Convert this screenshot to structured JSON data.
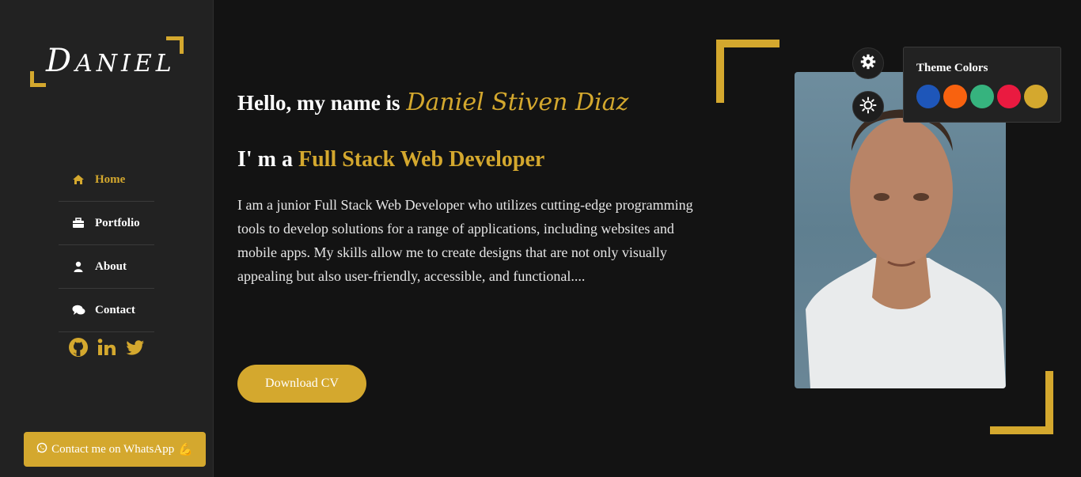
{
  "logo": {
    "first": "D",
    "rest": "ANIEL"
  },
  "nav": [
    {
      "label": "Home",
      "icon": "home-icon"
    },
    {
      "label": "Portfolio",
      "icon": "briefcase-icon"
    },
    {
      "label": "About",
      "icon": "user-icon"
    },
    {
      "label": "Contact",
      "icon": "comments-icon"
    }
  ],
  "socials": [
    "github-icon",
    "linkedin-icon",
    "twitter-icon"
  ],
  "whatsapp": {
    "label": "Contact me on WhatsApp",
    "emoji": "💪"
  },
  "hero": {
    "greeting": "Hello, my name is",
    "name": "Daniel Stiven Diaz",
    "role_prefix": "I' m a",
    "role": "Full Stack Web Developer",
    "bio": "I am a junior Full Stack Web Developer who utilizes cutting-edge programming tools to develop solutions for a range of applications, including websites and mobile apps. My skills allow me to create designs that are not only visually appealing but also user-friendly, accessible, and functional....",
    "cv_button": "Download CV"
  },
  "theme": {
    "title": "Theme Colors",
    "colors": [
      "#1e56b9",
      "#f8620f",
      "#36b37e",
      "#ea1a40",
      "#d4a82e"
    ]
  },
  "accent": "#d4a82e"
}
